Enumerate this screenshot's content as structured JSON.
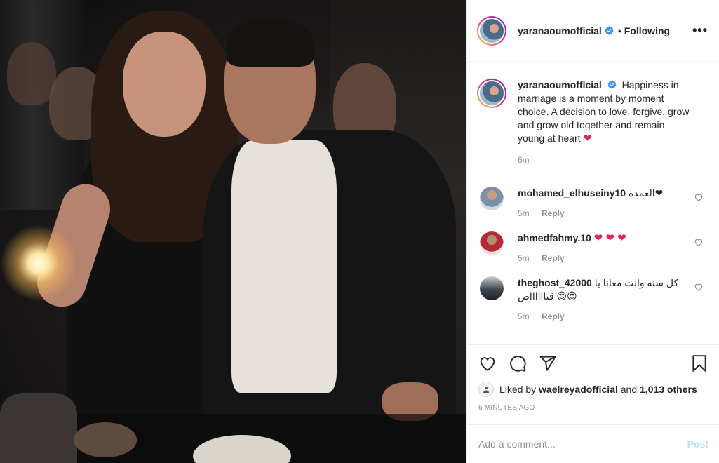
{
  "post": {
    "author": "yaranaoumofficial",
    "follow_status": "Following",
    "more_label": "•••",
    "caption": "Happiness in marriage is a moment by moment choice. A decision to love, forgive, grow and grow old together and remain young at heart",
    "caption_emoji": "❤",
    "caption_time": "6m"
  },
  "comments": [
    {
      "username": "mohamed_elhuseiny10",
      "text": "العمده❤",
      "time": "5m",
      "reply": "Reply"
    },
    {
      "username": "ahmedfahmy.10",
      "text": "❤ ❤ ❤",
      "time": "5m",
      "reply": "Reply"
    },
    {
      "username": "theghost_42000",
      "text": "كل سنه وانت معانا يا قنااااااص 😍😍",
      "time": "5m",
      "reply": "Reply"
    }
  ],
  "likes": {
    "prefix": "Liked by",
    "liker": "wael­reyadofficial",
    "joiner": "and",
    "others": "1,013 others"
  },
  "timestamp": "6 MINUTES AGO",
  "add_comment": {
    "placeholder": "Add a comment...",
    "post_label": "Post"
  },
  "colors": {
    "verified_blue": "#3897f0",
    "heart_red": "#e0245e",
    "post_disabled": "#b2dffc"
  },
  "icons": [
    "heart-icon",
    "comment-icon",
    "share-icon",
    "bookmark-icon",
    "verified-badge-icon",
    "more-options-icon"
  ]
}
